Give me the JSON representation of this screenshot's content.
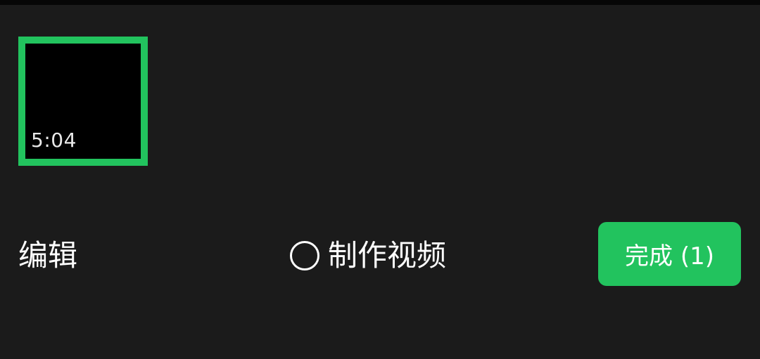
{
  "selected_video": {
    "duration": "5:04"
  },
  "bottom_bar": {
    "edit_label": "编辑",
    "make_video_label": "制作视频",
    "done_label": "完成 (1)"
  },
  "colors": {
    "accent": "#22c35e",
    "background": "#1b1b1b"
  }
}
